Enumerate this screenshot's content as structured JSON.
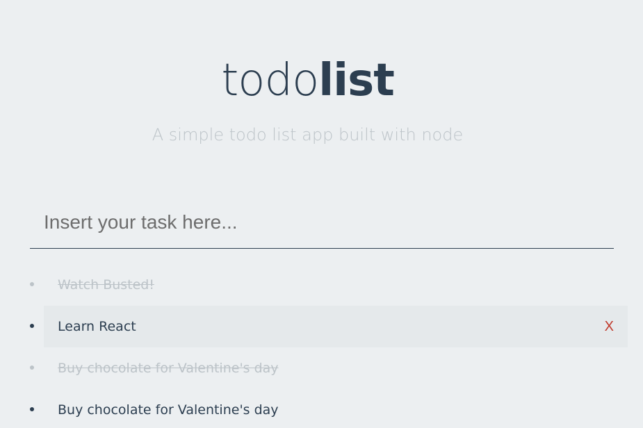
{
  "header": {
    "title_light": "todo",
    "title_bold": "list",
    "subtitle": "A simple todo list app built with node"
  },
  "task_input": {
    "placeholder": "Insert your task here...",
    "value": ""
  },
  "todos": [
    {
      "text": "Watch Busted!",
      "completed": true
    },
    {
      "text": "Learn React",
      "completed": false,
      "hovered": true,
      "delete_label": "X"
    },
    {
      "text": "Buy chocolate for Valentine's day",
      "completed": true
    },
    {
      "text": "Buy chocolate for Valentine's day",
      "completed": false
    }
  ],
  "colors": {
    "background": "#eceff1",
    "primary": "#2c3e50",
    "muted": "#bcc3c8",
    "hover_row": "#e5e9eb",
    "delete": "#c0392b"
  }
}
